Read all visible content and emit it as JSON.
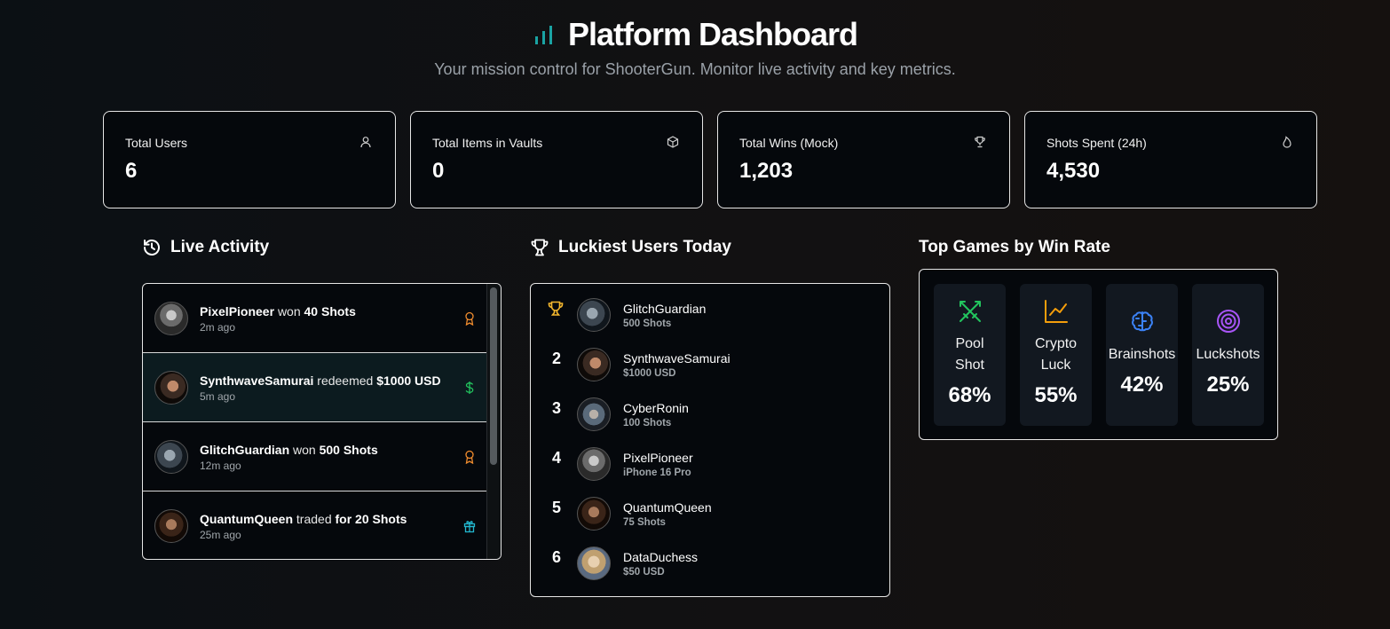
{
  "header": {
    "title": "Platform Dashboard",
    "subtitle": "Your mission control for ShooterGun. Monitor live activity and key metrics.",
    "accent_color": "#1aa3a3"
  },
  "stats": [
    {
      "label": "Total Users",
      "value": "6",
      "icon": "user-icon"
    },
    {
      "label": "Total Items in Vaults",
      "value": "0",
      "icon": "box-icon"
    },
    {
      "label": "Total Wins (Mock)",
      "value": "1,203",
      "icon": "trophy-icon"
    },
    {
      "label": "Shots Spent (24h)",
      "value": "4,530",
      "icon": "flame-icon"
    }
  ],
  "live_activity": {
    "title": "Live Activity",
    "items": [
      {
        "user": "PixelPioneer",
        "action": "won",
        "detail": "40 Shots",
        "time": "2m ago",
        "icon": "award-icon",
        "icon_color": "#f08c2e"
      },
      {
        "user": "SynthwaveSamurai",
        "action": "redeemed",
        "detail": "$1000 USD",
        "time": "5m ago",
        "icon": "dollar-icon",
        "icon_color": "#22c55e"
      },
      {
        "user": "GlitchGuardian",
        "action": "won",
        "detail": "500 Shots",
        "time": "12m ago",
        "icon": "award-icon",
        "icon_color": "#f08c2e"
      },
      {
        "user": "QuantumQueen",
        "action": "traded",
        "detail": "for 20 Shots",
        "time": "25m ago",
        "icon": "gift-icon",
        "icon_color": "#22b8cf"
      }
    ]
  },
  "luckiest_users": {
    "title": "Luckiest Users Today",
    "items": [
      {
        "rank": "",
        "rank_icon": "trophy-icon",
        "name": "GlitchGuardian",
        "prize": "500 Shots"
      },
      {
        "rank": "2",
        "name": "SynthwaveSamurai",
        "prize": "$1000 USD"
      },
      {
        "rank": "3",
        "name": "CyberRonin",
        "prize": "100 Shots"
      },
      {
        "rank": "4",
        "name": "PixelPioneer",
        "prize": "iPhone 16 Pro"
      },
      {
        "rank": "5",
        "name": "QuantumQueen",
        "prize": "75 Shots"
      },
      {
        "rank": "6",
        "name": "DataDuchess",
        "prize": "$50 USD"
      }
    ]
  },
  "top_games": {
    "title": "Top Games by Win Rate",
    "items": [
      {
        "name_line1": "Pool",
        "name_line2": "Shot",
        "rate": "68%",
        "icon": "crossed-swords-icon",
        "color": "#22c55e"
      },
      {
        "name_line1": "Crypto",
        "name_line2": "Luck",
        "rate": "55%",
        "icon": "line-chart-icon",
        "color": "#f59e0b"
      },
      {
        "name_line1": "Brainshots",
        "name_line2": "",
        "rate": "42%",
        "icon": "brain-icon",
        "color": "#3b82f6"
      },
      {
        "name_line1": "Luckshots",
        "name_line2": "",
        "rate": "25%",
        "icon": "target-icon",
        "color": "#a855f7"
      }
    ]
  }
}
